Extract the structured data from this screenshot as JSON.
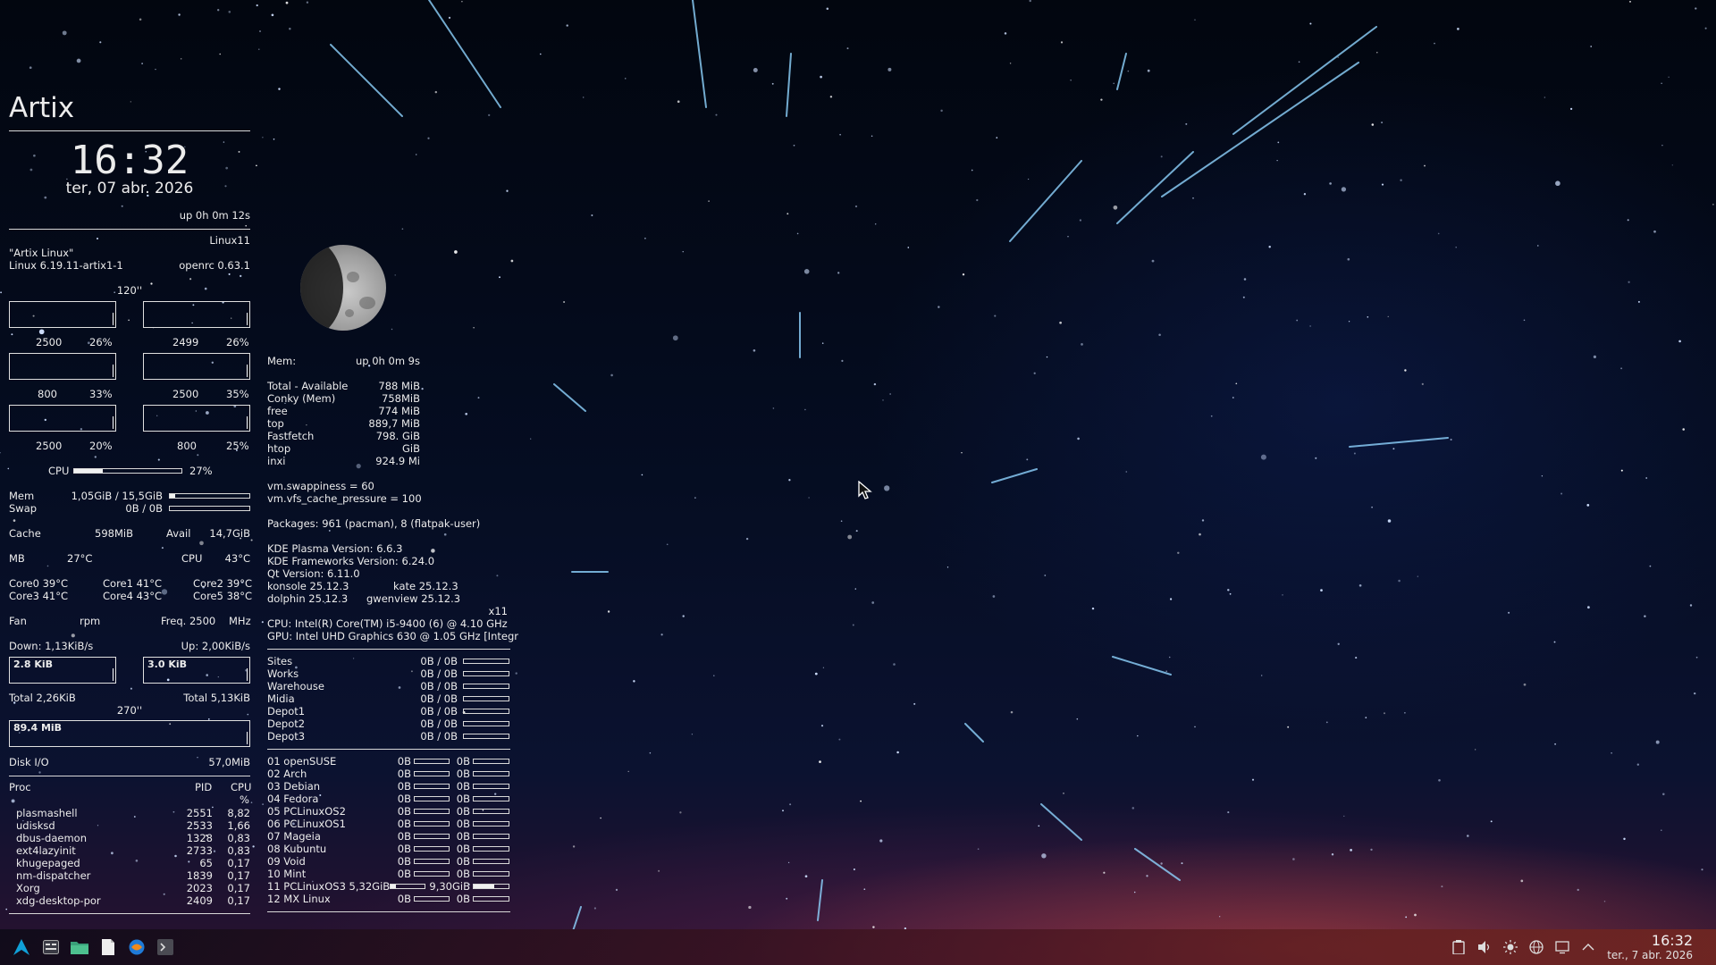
{
  "conky_left": {
    "title": "Artix",
    "time": "16:32",
    "date": "ter, 07 abr. 2026",
    "uptime": "up  0h 0m 12s",
    "hostname": "Linux11",
    "distro": "\"Artix Linux\"",
    "kernel": "Linux 6.19.11-artix1-1",
    "init": "openrc 0.63.1",
    "cpu_interval": "120''",
    "cores": [
      {
        "freq": "2500",
        "pct": "26%"
      },
      {
        "freq": "2499",
        "pct": "26%"
      },
      {
        "freq": "800",
        "pct": "33%"
      },
      {
        "freq": "2500",
        "pct": "35%"
      },
      {
        "freq": "2500",
        "pct": "20%"
      },
      {
        "freq": "800",
        "pct": "25%"
      }
    ],
    "cpu_label": "CPU",
    "cpu_total": "27%",
    "cpu_fill": 0.27,
    "mem_label": "Mem",
    "mem_value": "1,05GiB / 15,5GiB",
    "mem_fill": 0.07,
    "swap_label": "Swap",
    "swap_value": "0B / 0B",
    "cache_label": "Cache",
    "cache_value": "598MiB",
    "avail_label": "Avail",
    "avail_value": "14,7GiB",
    "mb_label": "MB",
    "mb_temp": "27°C",
    "cpu_temp_label": "CPU",
    "cpu_temp": "43°C",
    "core_temps": [
      "Core0  39°C",
      "Core1 41°C",
      "Core2  39°C",
      "Core3  41°C",
      "Core4  43°C",
      "Core5  38°C"
    ],
    "fan_label": "Fan",
    "fan_unit": "rpm",
    "freq_label": "Freq.  2500",
    "freq_unit": "MHz",
    "down": "Down: 1,13KiB/s",
    "up": "Up: 2,00KiB/s",
    "down_graph": "2.8 KiB",
    "up_graph": "3.0 KiB",
    "total_down": "Total 2,26KiB",
    "total_up": "Total 5,13KiB",
    "disk_interval": "270''",
    "disk_graph": "89.4 MiB",
    "disk_label": "Disk I/O",
    "disk_value": "57,0MiB",
    "proc_header": [
      "Proc",
      "PID",
      "CPU",
      "%"
    ],
    "processes": [
      {
        "name": "plasmashell",
        "pid": "2551",
        "cpu": "8,82"
      },
      {
        "name": "udisksd",
        "pid": "2533",
        "cpu": "1,66"
      },
      {
        "name": "dbus-daemon",
        "pid": "1328",
        "cpu": "0,83"
      },
      {
        "name": "ext4lazyinit",
        "pid": "2733",
        "cpu": "0,83"
      },
      {
        "name": "khugepaged",
        "pid": "65",
        "cpu": "0,17"
      },
      {
        "name": "nm-dispatcher",
        "pid": "1839",
        "cpu": "0,17"
      },
      {
        "name": "Xorg",
        "pid": "2023",
        "cpu": "0,17"
      },
      {
        "name": "xdg-desktop-por",
        "pid": "2409",
        "cpu": "0,17"
      }
    ]
  },
  "conky_right": {
    "mem_header": "Mem:",
    "uptime": "up  0h 0m 9s",
    "mem_rows": [
      {
        "label": "Total - Available",
        "value": "788 MiB"
      },
      {
        "label": "Conky (Mem)",
        "value": "758MiB"
      },
      {
        "label": "free",
        "value": "774    MiB"
      },
      {
        "label": "top",
        "value": "889,7  MiB"
      },
      {
        "label": "Fastfetch",
        "value": "798. GiB"
      },
      {
        "label": "htop",
        "value": "GiB"
      },
      {
        "label": "inxi",
        "value": "924.9 Mi"
      }
    ],
    "swappiness": "vm.swappiness = 60",
    "cache_pressure": "vm.vfs_cache_pressure = 100",
    "packages": "Packages: 961 (pacman), 8 (flatpak-user)",
    "plasma": "KDE Plasma Version: 6.6.3",
    "frameworks": "KDE Frameworks Version: 6.24.0",
    "qt": "Qt Version: 6.11.0",
    "konsole": "konsole 25.12.3",
    "kate": "kate 25.12.3",
    "dolphin": "dolphin 25.12.3",
    "gwenview": "gwenview 25.12.3",
    "session": "x11",
    "cpu_info": "CPU: Intel(R) Core(TM) i5-9400 (6) @ 4.10 GHz",
    "gpu_info": "GPU: Intel UHD Graphics 630 @ 1.05 GHz [Integr",
    "drives": [
      {
        "name": "Sites",
        "value": "0B  /  0B"
      },
      {
        "name": "Works",
        "value": "0B  /  0B"
      },
      {
        "name": "Warehouse",
        "value": "0B  /  0B"
      },
      {
        "name": "Midia",
        "value": "0B  /  0B"
      },
      {
        "name": "Depot1",
        "value": "0B  /  0B"
      },
      {
        "name": "Depot2",
        "value": "0B  /  0B"
      },
      {
        "name": "Depot3",
        "value": "0B  /  0B"
      }
    ],
    "systems": [
      {
        "name": "01 openSUSE",
        "a": "0B",
        "b": "0B",
        "fill_a": 0,
        "fill_b": 0
      },
      {
        "name": "02 Arch",
        "a": "0B",
        "b": "0B",
        "fill_a": 0,
        "fill_b": 0
      },
      {
        "name": "03 Debian",
        "a": "0B",
        "b": "0B",
        "fill_a": 0,
        "fill_b": 0
      },
      {
        "name": "04 Fedora",
        "a": "0B",
        "b": "0B",
        "fill_a": 0,
        "fill_b": 0
      },
      {
        "name": "05 PCLinuxOS2",
        "a": "0B",
        "b": "0B",
        "fill_a": 0,
        "fill_b": 0
      },
      {
        "name": "06 PCLinuxOS1",
        "a": "0B",
        "b": "0B",
        "fill_a": 0,
        "fill_b": 0
      },
      {
        "name": "07 Mageia",
        "a": "0B",
        "b": "0B",
        "fill_a": 0,
        "fill_b": 0
      },
      {
        "name": "08 Kubuntu",
        "a": "0B",
        "b": "0B",
        "fill_a": 0,
        "fill_b": 0
      },
      {
        "name": "09 Void",
        "a": "0B",
        "b": "0B",
        "fill_a": 0,
        "fill_b": 0
      },
      {
        "name": "10 Mint",
        "a": "0B",
        "b": "0B",
        "fill_a": 0,
        "fill_b": 0
      },
      {
        "name": "11 PCLinuxOS3 5,32GiB",
        "a": "",
        "b": "9,30GiB",
        "fill_a": 0.15,
        "fill_b": 0.6
      },
      {
        "name": "12 MX Linux",
        "a": "0B",
        "b": "0B",
        "fill_a": 0,
        "fill_b": 0
      }
    ]
  },
  "taskbar": {
    "clock_time": "16:32",
    "clock_date": "ter., 7 abr. 2026",
    "launchers": [
      "artix-logo-icon",
      "app-menu-icon",
      "file-manager-icon",
      "text-editor-icon",
      "browser-icon",
      "terminal-icon"
    ],
    "tray": [
      "clipboard-icon",
      "volume-icon",
      "brightness-icon",
      "network-icon",
      "display-icon",
      "tray-expand-icon"
    ]
  }
}
